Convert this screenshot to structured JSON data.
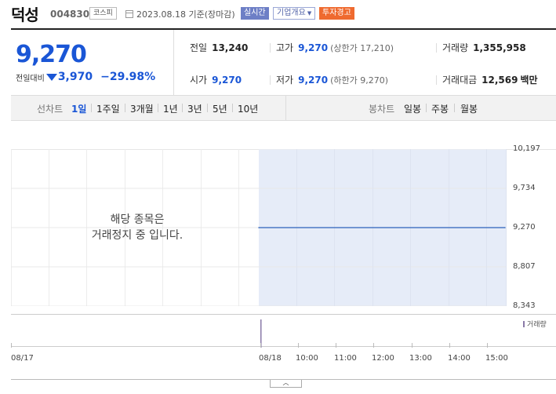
{
  "header": {
    "stock_name": "덕성",
    "stock_code": "004830",
    "market_badge": "코스피",
    "date_text": "2023.08.18 기준(장마감)",
    "realtime_badge": "실시간",
    "company_info_label": "기업개요",
    "warning_badge": "투자경고"
  },
  "quote": {
    "price": "9,270",
    "change_label": "전일대비",
    "change_amount": "3,970",
    "change_percent": "−29.98%",
    "prev_close_label": "전일",
    "prev_close": "13,240",
    "high_label": "고가",
    "high": "9,270",
    "upper_limit": "(상한가 17,210)",
    "volume_label": "거래량",
    "volume": "1,355,958",
    "open_label": "시가",
    "open": "9,270",
    "low_label": "저가",
    "low": "9,270",
    "lower_limit": "(하한가 9,270)",
    "amount_label": "거래대금",
    "amount": "12,569",
    "amount_unit": "백만"
  },
  "tabs": {
    "line_chart_label": "선차트",
    "line_periods": [
      "1일",
      "1주일",
      "3개월",
      "1년",
      "3년",
      "5년",
      "10년"
    ],
    "candle_chart_label": "봉차트",
    "candle_periods": [
      "일봉",
      "주봉",
      "월봉"
    ],
    "colors": {
      "active": "#1a56d6"
    }
  },
  "chart": {
    "halt_line1": "해당 종목은",
    "halt_line2": "거래정지 중 입니다.",
    "volume_legend": "거래량",
    "expand_icon": "chevron-up-icon"
  },
  "chart_data": {
    "type": "line",
    "y_ticks": [
      "10,197",
      "9,734",
      "9,270",
      "8,807",
      "8,343"
    ],
    "y_tick_values": [
      10197,
      9734,
      9270,
      8807,
      8343
    ],
    "ylim": [
      8343,
      10197
    ],
    "x_ticks": [
      "08/17",
      "08/18",
      "10:00",
      "11:00",
      "12:00",
      "13:00",
      "14:00",
      "15:00"
    ],
    "series": [
      {
        "values": [
          9270,
          9270
        ]
      }
    ],
    "colors": {
      "line": "#4a78c4",
      "area": "#e6ecf8"
    },
    "grid": true
  }
}
